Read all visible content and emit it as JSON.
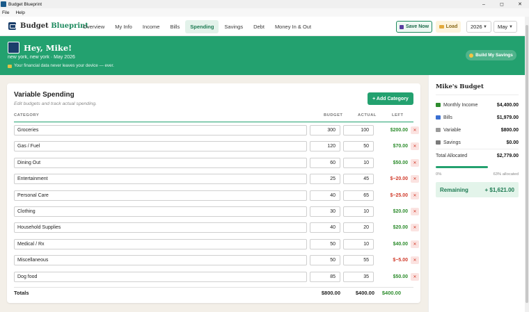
{
  "window": {
    "title": "Budget Blueprint",
    "minimize": "–",
    "maximize": "◻",
    "close": "✕"
  },
  "menu": [
    "File",
    "Help"
  ],
  "brand": {
    "name": "Budget",
    "accent": "Blueprint"
  },
  "nav": [
    "Overview",
    "My Info",
    "Income",
    "Bills",
    "Spending",
    "Savings",
    "Debt",
    "Money In & Out"
  ],
  "nav_active": "Spending",
  "toolbar": {
    "save_label": "Save Now",
    "load_label": "Load",
    "year": "2026",
    "month": "May"
  },
  "hero": {
    "greeting": "Hey, Mike!",
    "location": "new york, new york · May 2026",
    "privacy": "Your financial data never leaves your device — ever.",
    "build_button": "Build My Savings"
  },
  "spending": {
    "title": "Variable Spending",
    "subtitle": "Edit budgets and track actual spending.",
    "add_button": "+ Add Category",
    "columns": {
      "category": "CATEGORY",
      "budget": "BUDGET",
      "actual": "ACTUAL",
      "left": "LEFT"
    },
    "rows": [
      {
        "category": "Groceries",
        "budget": "300",
        "actual": "100",
        "left": "$200.00",
        "status": "pos"
      },
      {
        "category": "Gas / Fuel",
        "budget": "120",
        "actual": "50",
        "left": "$70.00",
        "status": "pos"
      },
      {
        "category": "Dining Out",
        "budget": "60",
        "actual": "10",
        "left": "$50.00",
        "status": "pos"
      },
      {
        "category": "Entertainment",
        "budget": "25",
        "actual": "45",
        "left": "$−20.00",
        "status": "neg"
      },
      {
        "category": "Personal Care",
        "budget": "40",
        "actual": "65",
        "left": "$−25.00",
        "status": "neg"
      },
      {
        "category": "Clothing",
        "budget": "30",
        "actual": "10",
        "left": "$20.00",
        "status": "pos"
      },
      {
        "category": "Household Supplies",
        "budget": "40",
        "actual": "20",
        "left": "$20.00",
        "status": "pos"
      },
      {
        "category": "Medical / Rx",
        "budget": "50",
        "actual": "10",
        "left": "$40.00",
        "status": "pos"
      },
      {
        "category": "Miscellaneous",
        "budget": "50",
        "actual": "55",
        "left": "$−5.00",
        "status": "neg"
      },
      {
        "category": "Dog food",
        "budget": "85",
        "actual": "35",
        "left": "$50.00",
        "status": "pos"
      }
    ],
    "delete_label": "✕",
    "totals": {
      "label": "Totals",
      "budget": "$800.00",
      "actual": "$400.00",
      "left": "$400.00"
    }
  },
  "sidebar": {
    "title": "Mike's Budget",
    "items": [
      {
        "label": "Monthly Income",
        "amount": "$4,400.00",
        "color": "#2d8c2d"
      },
      {
        "label": "Bills",
        "amount": "$1,979.00",
        "color": "#3a6fd1"
      },
      {
        "label": "Variable",
        "amount": "$800.00",
        "color": "#9a9a9a"
      },
      {
        "label": "Savings",
        "amount": "$0.00",
        "color": "#7a7a7a"
      }
    ],
    "total_label": "Total Allocated",
    "total_amount": "$2,779.00",
    "progress_left": "0%",
    "progress_right": "63% allocated",
    "progress_fraction": 0.63,
    "remaining_label": "Remaining",
    "remaining_amount": "+ $1,621.00"
  }
}
